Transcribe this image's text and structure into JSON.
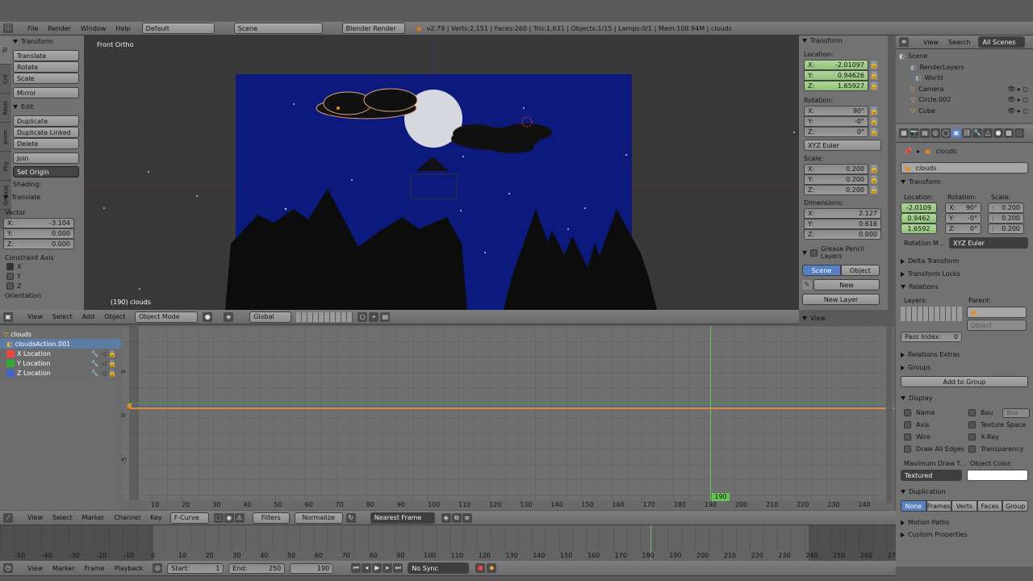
{
  "topbar": {
    "menus": [
      "File",
      "Render",
      "Window",
      "Help"
    ],
    "layout": "Default",
    "scene": "Scene",
    "engine": "Blender Render",
    "stats": "v2.79 | Verts:2,151 | Faces:260 | Tris:1,631 | Objects:1/15 | Lamps:0/1 | Mem:108.94M | clouds"
  },
  "toolshelf": {
    "tabs": [
      "To",
      "Cre",
      "Relat",
      "Anim",
      "Phy",
      "Grease"
    ],
    "transform_title": "Transform",
    "transform_buttons": [
      "Translate",
      "Rotate",
      "Scale",
      "Mirror"
    ],
    "edit_title": "Edit",
    "edit_buttons": [
      "Duplicate",
      "Duplicate Linked",
      "Delete",
      "Join"
    ],
    "set_origin": "Set Origin",
    "shading": "Shading:",
    "translate_title": "Translate",
    "vector_label": "Vector",
    "vector": [
      {
        "k": "X:",
        "v": "-3.104"
      },
      {
        "k": "Y:",
        "v": "0.000"
      },
      {
        "k": "Z:",
        "v": "0.000"
      }
    ],
    "constraint_label": "Constraint Axis",
    "axes": [
      "X",
      "Y",
      "Z"
    ],
    "orientation": "Orientation"
  },
  "viewport": {
    "view_name": "Front Ortho",
    "object_label": "(190) clouds",
    "menus": [
      "View",
      "Select",
      "Add",
      "Object"
    ],
    "mode": "Object Mode",
    "orientation": "Global"
  },
  "npanel": {
    "title": "Transform",
    "location_label": "Location:",
    "location": [
      {
        "k": "X:",
        "v": "-2.01097"
      },
      {
        "k": "Y:",
        "v": "0.94626"
      },
      {
        "k": "Z:",
        "v": "1.65927"
      }
    ],
    "rotation_label": "Rotation:",
    "rotation": [
      {
        "k": "X:",
        "v": "90°"
      },
      {
        "k": "Y:",
        "v": "-0°"
      },
      {
        "k": "Z:",
        "v": "0°"
      }
    ],
    "euler": "XYZ Euler",
    "scale_label": "Scale:",
    "scale": [
      {
        "k": "X:",
        "v": "0.200"
      },
      {
        "k": "Y:",
        "v": "0.200"
      },
      {
        "k": "Z:",
        "v": "0.200"
      }
    ],
    "dim_label": "Dimensions:",
    "dims": [
      {
        "k": "X:",
        "v": "2.127"
      },
      {
        "k": "Y:",
        "v": "0.616"
      },
      {
        "k": "Z:",
        "v": "0.000"
      }
    ],
    "gp_title": "Grease Pencil Layers",
    "gp_tabs": [
      "Scene",
      "Object"
    ],
    "gp_new": "New",
    "gp_new_layer": "New Layer",
    "view_title": "View"
  },
  "outliner": {
    "menus": [
      "View",
      "Search"
    ],
    "filter": "All Scenes",
    "items": [
      "Scene",
      "RenderLayers",
      "World",
      "Camera",
      "Circle.002",
      "Cube"
    ]
  },
  "props": {
    "breadcrumb": "clouds",
    "name": "clouds",
    "transform_title": "Transform",
    "loc_label": "Location:",
    "rot_label": "Rotation:",
    "scale_label": "Scale:",
    "loc": [
      "-2.0109",
      "0.9462",
      "1.6592"
    ],
    "rot": [
      {
        "k": "X:",
        "v": "90°"
      },
      {
        "k": "Y:",
        "v": "-0°"
      },
      {
        "k": "Z:",
        "v": "0°"
      }
    ],
    "scale": [
      {
        "k": ":",
        "v": "0.200"
      },
      {
        "k": ":",
        "v": "0.200"
      },
      {
        "k": ":",
        "v": "0.200"
      }
    ],
    "rotmode_label": "Rotation M...",
    "rotmode": "XYZ Euler",
    "delta": "Delta Transform",
    "locks": "Transform Locks",
    "relations": "Relations",
    "layers_label": "Layers:",
    "parent_label": "Parent:",
    "parent_type": "Object",
    "pass_index_label": "Pass Index:",
    "pass_index": "0",
    "relations_extras": "Relations Extras",
    "groups": "Groups",
    "add_group": "Add to Group",
    "display": "Display",
    "display_left": [
      "Name",
      "Axis",
      "Wire",
      "Draw All Edges"
    ],
    "display_right": [
      "Bou",
      "Texture Space",
      "X-Ray",
      "Transparency"
    ],
    "bounds_type": "Box",
    "max_draw_label": "Maximum Draw T...",
    "obj_color_label": "Object Color:",
    "draw_type": "Textured",
    "duplication": "Duplication",
    "dup_tabs": [
      "None",
      "Frames",
      "Verts",
      "Faces",
      "Group"
    ],
    "motion_paths": "Motion Paths",
    "custom_props": "Custom Properties"
  },
  "graph": {
    "channels": [
      "clouds",
      "cloudsAction.001",
      "X Location",
      "Y Location",
      "Z Location"
    ],
    "ticks": [
      "10",
      "20",
      "30",
      "40",
      "50",
      "60",
      "70",
      "80",
      "90",
      "100",
      "110",
      "120",
      "130",
      "140",
      "150",
      "160",
      "170",
      "180",
      "190",
      "200",
      "210",
      "220",
      "230",
      "240"
    ],
    "current_frame": "190",
    "y_labels": [
      "5",
      "0",
      "-5"
    ],
    "menus": [
      "View",
      "Select",
      "Marker",
      "Channel",
      "Key"
    ],
    "editor_mode": "F-Curve",
    "filters": "Filters",
    "normalize": "Normalize",
    "snap": "Nearest Frame"
  },
  "timeline": {
    "ticks": [
      "-50",
      "-40",
      "-30",
      "-20",
      "-10",
      "0",
      "10",
      "20",
      "30",
      "40",
      "50",
      "60",
      "70",
      "80",
      "90",
      "100",
      "110",
      "120",
      "130",
      "140",
      "150",
      "160",
      "170",
      "180",
      "190",
      "200",
      "210",
      "220",
      "230",
      "240",
      "250",
      "260",
      "270",
      "280"
    ],
    "menus": [
      "View",
      "Marker",
      "Frame",
      "Playback"
    ],
    "start_label": "Start:",
    "start": "1",
    "end_label": "End:",
    "end": "250",
    "frame": "190",
    "sync": "No Sync"
  }
}
